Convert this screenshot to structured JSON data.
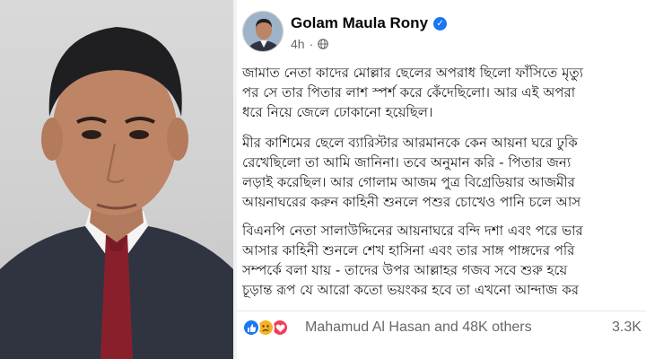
{
  "post": {
    "author": "Golam Maula Rony",
    "time": "4h",
    "separator": "·",
    "paragraphs": [
      {
        "lines": [
          "জামাত নেতা কাদের মোল্লার ছেলের অপরাধ ছিলো ফাঁসিতে মৃত্যু",
          "পর সে তার পিতার লাশ স্পর্শ করে কেঁদেছিলো। আর এই অপরা",
          "ধরে নিয়ে জেলে ঢোকানো হয়েছিল।"
        ]
      },
      {
        "lines": [
          "মীর কাশিমের ছেলে ব্যারিস্টার আরমানকে কেন আয়না ঘরে ঢুকি",
          "রেখেছিলো তা আমি জানিনা। তবে অনুমান করি  - পিতার জন্য",
          "লড়াই করেছিল। আর গোলাম আজম পুত্র বিগ্রেডিয়ার আজমীর",
          "আয়নাঘরের করুন কাহিনী শুনলে পশুর চোখেও পানি চলে আস"
        ]
      },
      {
        "lines": [
          "বিএনপি নেতা সালাউদ্দিনের আয়নাঘরে বন্দি দশা এবং পরে ভার",
          "আসার কাহিনী শুনলে শেখ হাসিনা এবং তার সাঙ্গ পাঙ্গদের পরি",
          "সম্পর্কে বলা যায়  - তাদের উপর আল্লাহর গজব সবে শুরু হয়ে",
          "চূড়ান্ত রূপ যে আরো কতো ভয়ংকর হবে তা এখনো আন্দাজ কর"
        ]
      }
    ],
    "reactions": {
      "icons": [
        "like-icon",
        "sad-icon",
        "love-icon"
      ],
      "text": "Mahamud Al Hasan and 48K others",
      "comments": "3.3K"
    }
  },
  "colors": {
    "verified": "#1877f2",
    "like": "#1877f2",
    "sad": "#f7b125",
    "love": "#f33e58",
    "text": "#1c1e21",
    "muted": "#65676b"
  }
}
